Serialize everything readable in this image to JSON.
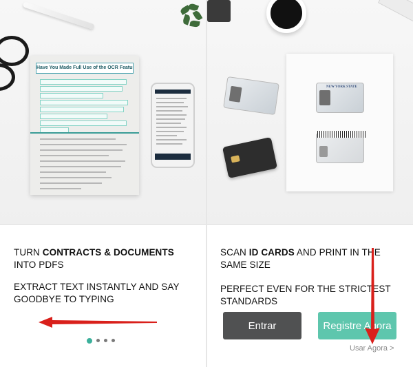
{
  "slides": [
    {
      "caption_line1_prefix": "TURN ",
      "caption_line1_bold": "CONTRACTS & DOCUMENTS",
      "caption_line2": "INTO PDFS",
      "caption2_line1": "EXTRACT TEXT INSTANTLY AND SAY",
      "caption2_line2": "GOODBYE TO TYPING",
      "doc_title": "Have You Made Full Use of the OCR Feature?"
    },
    {
      "caption_line1_prefix": "SCAN ",
      "caption_line1_bold": "ID CARDS",
      "caption_line1_suffix": " AND PRINT IN THE",
      "caption_line2": "SAME SIZE",
      "caption2_line1": "PERFECT EVEN FOR THE STRICTEST",
      "caption2_line2": "STANDARDS",
      "id_header": "NEW YORK STATE"
    }
  ],
  "pager": {
    "count": 4,
    "active_index": 0
  },
  "buttons": {
    "login_label": "Entrar",
    "register_label": "Registre Agora"
  },
  "skip_link": "Usar Agora >",
  "colors": {
    "accent_green": "#5ec6ad",
    "dark_button": "#505152",
    "annotation_red": "#d9201b",
    "pager_active": "#3cb09b"
  },
  "icons": [
    "arrow-left-annotation-icon",
    "arrow-down-annotation-icon"
  ]
}
